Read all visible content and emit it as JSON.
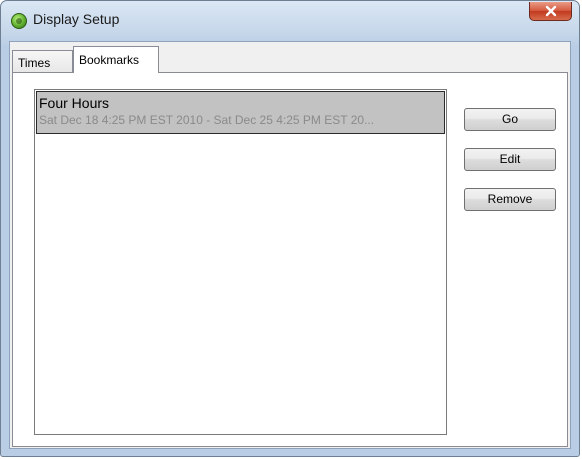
{
  "window": {
    "title": "Display Setup",
    "close_symbol": "X"
  },
  "tabs": [
    {
      "label": "Times",
      "selected": false
    },
    {
      "label": "Bookmarks",
      "selected": true
    }
  ],
  "bookmarks": [
    {
      "name": "Four Hours",
      "detail": "Sat Dec 18 4:25 PM EST 2010 - Sat Dec 25 4:25 PM EST 20...",
      "selected": true
    }
  ],
  "buttons": {
    "go": "Go",
    "edit": "Edit",
    "remove": "Remove"
  },
  "icons": {
    "app": "green-globe-icon",
    "close": "close-icon"
  }
}
